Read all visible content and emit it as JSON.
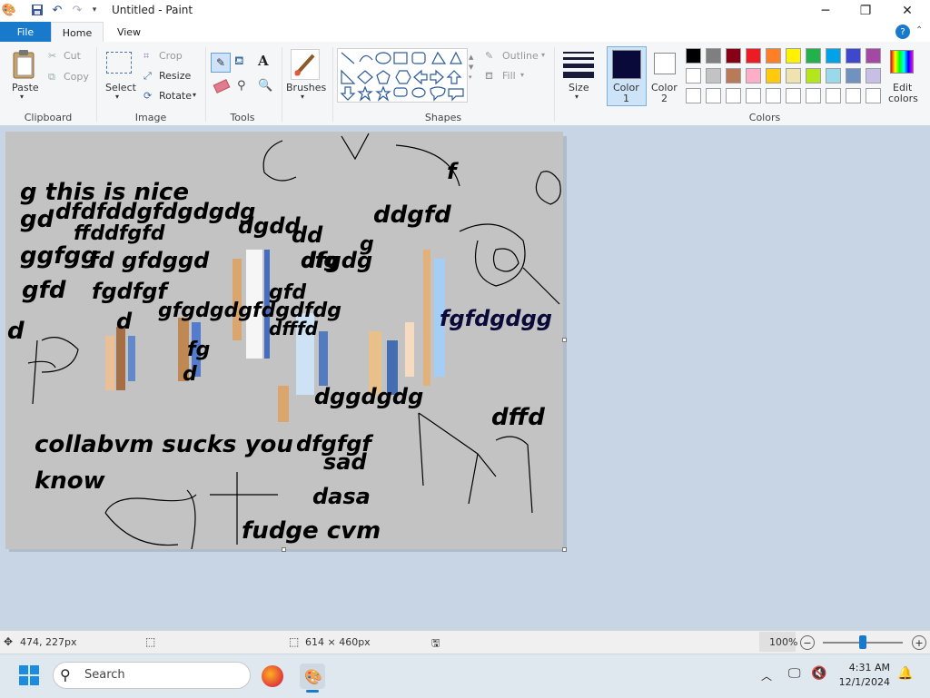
{
  "title_bar": {
    "title": "Untitled - Paint",
    "minimize": "─",
    "maximize": "❐",
    "close": "✕"
  },
  "tabs": {
    "file": "File",
    "home": "Home",
    "view": "View"
  },
  "ribbon": {
    "clipboard": {
      "label": "Clipboard",
      "paste": "Paste",
      "cut": "Cut",
      "copy": "Copy"
    },
    "image": {
      "label": "Image",
      "select": "Select",
      "crop": "Crop",
      "resize": "Resize",
      "rotate": "Rotate"
    },
    "tools": {
      "label": "Tools"
    },
    "brushes": {
      "label": "Brushes"
    },
    "shapes": {
      "label": "Shapes",
      "outline": "Outline",
      "fill": "Fill"
    },
    "size": {
      "label": "Size"
    },
    "color1": {
      "label1": "Color",
      "label2": "1",
      "value": "#0a0a3a"
    },
    "color2": {
      "label1": "Color",
      "label2": "2",
      "value": "#ffffff"
    },
    "colors": {
      "label": "Colors",
      "edit_label1": "Edit",
      "edit_label2": "colors"
    }
  },
  "palette": {
    "row1": [
      "#000000",
      "#7f7f7f",
      "#880015",
      "#ed1c24",
      "#ff7f27",
      "#fff200",
      "#22b14c",
      "#00a2e8",
      "#3f48cc",
      "#a349a4"
    ],
    "row2": [
      "#ffffff",
      "#c3c3c3",
      "#b97a57",
      "#ffaec9",
      "#ffc90e",
      "#efe4b0",
      "#b5e61d",
      "#99d9ea",
      "#7092be",
      "#c8bfe7"
    ],
    "row3": [
      "#ffffff",
      "#ffffff",
      "#ffffff",
      "#ffffff",
      "#ffffff",
      "#ffffff",
      "#ffffff",
      "#ffffff",
      "#ffffff",
      "#ffffff"
    ]
  },
  "canvas": {
    "texts": [
      "g this is nice",
      "gd",
      "dfdfddgfdgdgdg",
      "ddgfd",
      "dgdd",
      "dfgdg",
      "g",
      "ffddfgfd",
      "dd",
      "ggfgg",
      "fd gfdggd",
      "dfg",
      "gfd",
      "fgdfgf",
      "gfd",
      "d",
      "d",
      "gfgdgdgfdgdfdg",
      "dfffd",
      "fgfdgdgg",
      "fg",
      "d",
      "dggdgdg",
      "dffd",
      "collabvm sucks you",
      "dfgfgf",
      "know",
      "sad",
      "dasa",
      "fudge cvm",
      "f"
    ]
  },
  "status": {
    "cursor_pos": "474, 227px",
    "canvas_size": "614 × 460px",
    "zoom": "100%",
    "zoom_minus": "−",
    "zoom_plus": "+"
  },
  "taskbar": {
    "search_placeholder": "Search",
    "time": "4:31 AM",
    "date": "12/1/2024"
  }
}
